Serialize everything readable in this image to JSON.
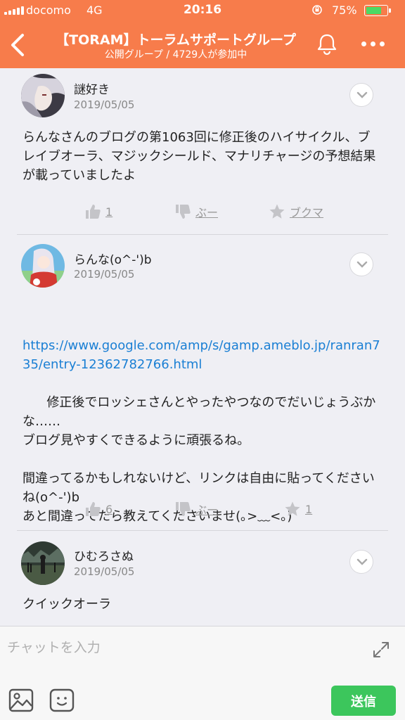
{
  "status_bar": {
    "carrier": "docomo",
    "network": "4G",
    "time": "20:16",
    "battery_percent": "75%",
    "battery_level": 0.75
  },
  "nav": {
    "title": "【TORAM】トーラムサポートグループ",
    "subtitle": "公開グループ / 4729人が参加中",
    "back_icon": "chevron-left-icon",
    "bell_icon": "bell-icon",
    "more_icon": "more-dots-icon"
  },
  "comments": [
    {
      "author": "謎好き",
      "date": "2019/05/05",
      "body": "らんなさんのブログの第1063回に修正後のハイサイクル、ブレイブオーラ、マジックシールド、マナリチャージの予想結果が載っていましたよ",
      "like_count": "1",
      "boo_label": "ぶー",
      "bookmark_label": "ブクマ"
    },
    {
      "author": "らんな(o^-')b",
      "date": "2019/05/05",
      "link": "https://www.google.com/amp/s/gamp.ameblo.jp/ranran735/entry-12362782766.html",
      "body": "修正後でロッシェさんとやったやつなのでだいじょうぶかな……\nブログ見やすくできるように頑張るね。\n\n間違ってるかもしれないけど、リンクは自由に貼ってくださいね(o^-')b\nあと間違ってたら教えてくださいませ(｡>﹏<｡)",
      "like_count": "6",
      "boo_label": "ぶー",
      "bookmark_count": "1"
    },
    {
      "author": "ひむろさぬ",
      "date": "2019/05/05",
      "body": "クイックオーラ"
    }
  ],
  "composer": {
    "placeholder": "チャットを入力",
    "send_label": "送信"
  },
  "colors": {
    "header": "#f77c4b",
    "link": "#1a7fd4",
    "send": "#3cc65c",
    "battery": "#4cd964"
  }
}
